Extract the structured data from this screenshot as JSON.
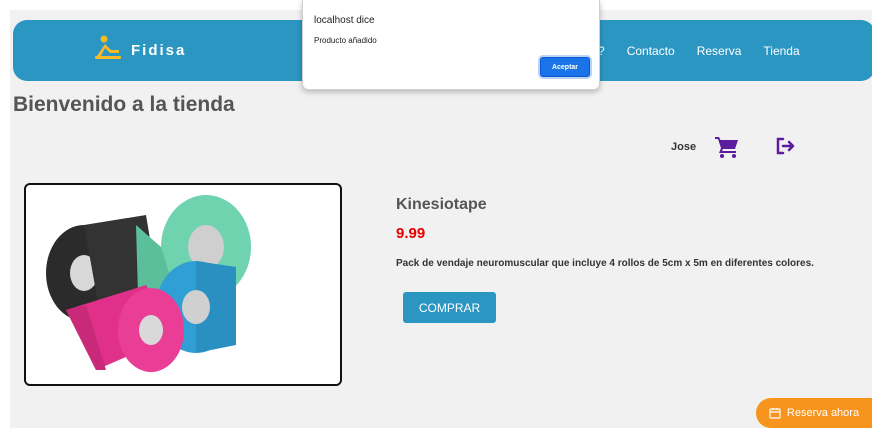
{
  "nav": {
    "brand": "Fidisa",
    "partial_link": "?",
    "links": [
      "Contacto",
      "Reserva",
      "Tienda"
    ]
  },
  "page": {
    "title": "Bienvenido a la tienda"
  },
  "user": {
    "name": "Jose"
  },
  "product": {
    "name": "Kinesiotape",
    "price": "9.99",
    "description": "Pack de vendaje neuromuscular que incluye 4 rollos de 5cm x 5m en diferentes colores.",
    "buy_label": "COMPRAR"
  },
  "floating": {
    "reserva_label": "Reserva ahora"
  },
  "dialog": {
    "title": "localhost dice",
    "message": "Producto añadido",
    "ok_label": "Aceptar"
  },
  "colors": {
    "navbar": "#2c96c3",
    "accent_orange": "#f7941d",
    "price": "#e60000",
    "icons_purple": "#5b1d9e"
  },
  "icons": [
    "massage-logo-icon",
    "cart-icon",
    "logout-icon",
    "calendar-icon"
  ]
}
